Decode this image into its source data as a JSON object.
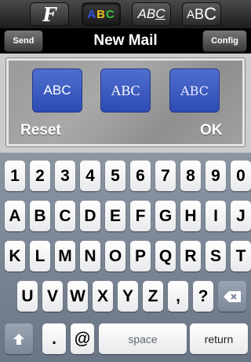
{
  "toolbar": {
    "font_label": "F",
    "color_letters": [
      {
        "char": "A",
        "color": "#2f52e0"
      },
      {
        "char": "B",
        "color": "#e9c21e"
      },
      {
        "char": "C",
        "color": "#37c23a"
      }
    ],
    "underline_label": "ABC",
    "size_label": "ABC"
  },
  "navbar": {
    "title": "New Mail",
    "send_label": "Send",
    "config_label": "Config"
  },
  "panel": {
    "style_buttons": [
      "ABC",
      "ABC",
      "ABC"
    ],
    "reset_label": "Reset",
    "ok_label": "OK"
  },
  "keyboard": {
    "row1": [
      "1",
      "2",
      "3",
      "4",
      "5",
      "6",
      "7",
      "8",
      "9",
      "0"
    ],
    "row2": [
      "A",
      "B",
      "C",
      "D",
      "E",
      "F",
      "G",
      "H",
      "I",
      "J"
    ],
    "row3": [
      "K",
      "L",
      "M",
      "N",
      "O",
      "P",
      "Q",
      "R",
      "S",
      "T"
    ],
    "row4": [
      "U",
      "V",
      "W",
      "X",
      "Y",
      "Z",
      ",",
      "?"
    ],
    "backspace_icon": "backspace-icon",
    "shift_icon": "shift-arrow-icon",
    "bottom": {
      "period": ".",
      "at": "@",
      "space_label": "space",
      "return_label": "return"
    }
  }
}
